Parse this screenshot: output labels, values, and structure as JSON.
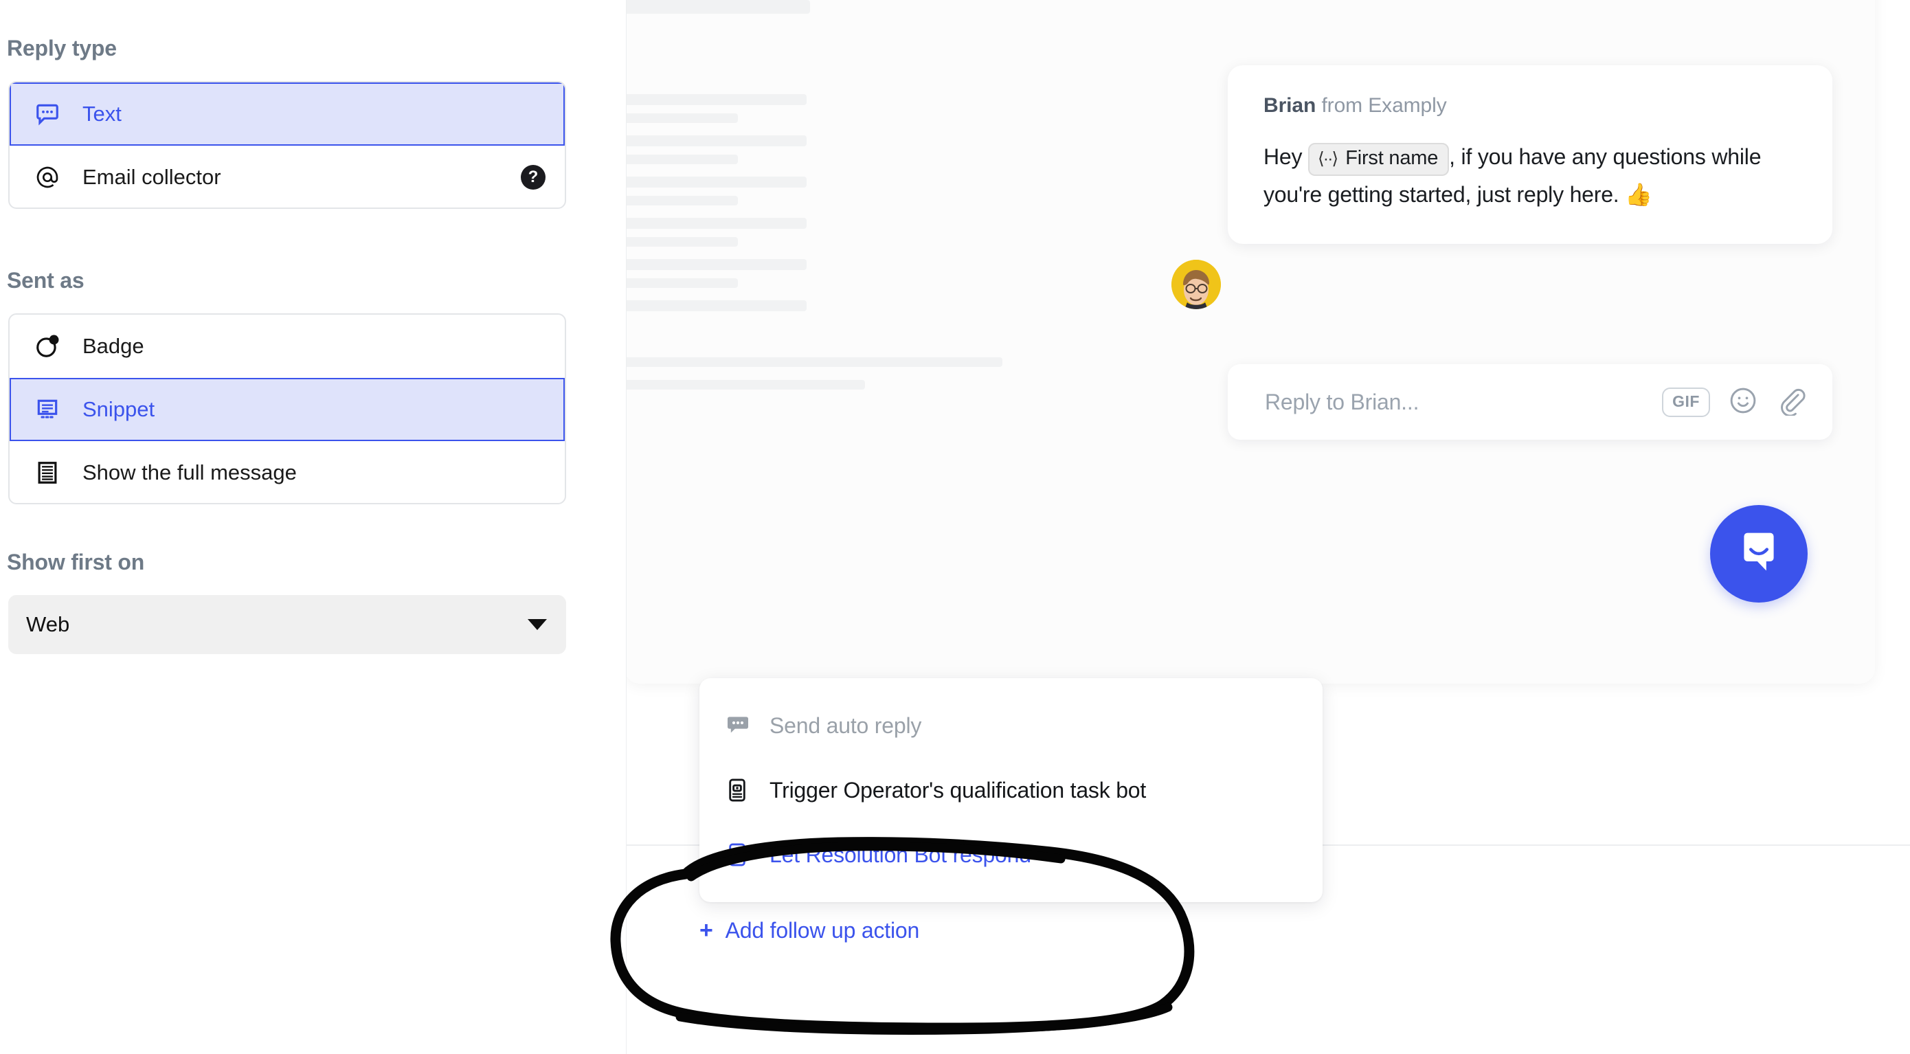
{
  "sidebar": {
    "reply_type": {
      "label": "Reply type",
      "options": [
        {
          "label": "Text",
          "icon": "chat-bubble-dots-icon",
          "selected": true,
          "help": null
        },
        {
          "label": "Email collector",
          "icon": "at-sign-icon",
          "selected": false,
          "help": "?"
        }
      ]
    },
    "sent_as": {
      "label": "Sent as",
      "options": [
        {
          "label": "Badge",
          "icon": "badge-dot-icon",
          "selected": false
        },
        {
          "label": "Snippet",
          "icon": "snippet-icon",
          "selected": true
        },
        {
          "label": "Show the full message",
          "icon": "full-message-icon",
          "selected": false
        }
      ]
    },
    "show_first_on": {
      "label": "Show first on",
      "value": "Web",
      "caret_icon": "caret-down-icon"
    }
  },
  "preview": {
    "message": {
      "sender_name": "Brian",
      "sender_suffix": "from Examply",
      "body_before": "Hey",
      "attribute_pill": {
        "icon": "code-attribute-icon",
        "label": "First name"
      },
      "body_after": ", if you have any questions while you're getting started, just reply here.",
      "emoji": "👍",
      "avatar_name": "avatar"
    },
    "composer": {
      "placeholder": "Reply to Brian...",
      "tools": [
        {
          "name": "gif-button",
          "label": "GIF"
        },
        {
          "name": "emoji-button",
          "label": "emoji-smiley-icon"
        },
        {
          "name": "attachment-button",
          "label": "paperclip-icon"
        }
      ]
    },
    "launcher": {
      "name": "messenger-launcher-button",
      "icon": "intercom-logo-icon"
    }
  },
  "actions_menu": {
    "items": [
      {
        "label": "Send auto reply",
        "icon": "chat-bubble-dots-icon",
        "state": "muted"
      },
      {
        "label": "Trigger Operator's qualification task bot",
        "icon": "bot-icon",
        "state": "dark"
      },
      {
        "label": "Let Resolution Bot respond",
        "icon": "bot-icon",
        "state": "accent"
      }
    ],
    "add_action": {
      "plus": "+",
      "label": "Add follow up action"
    }
  },
  "annotation": {
    "type": "hand-drawn-circle",
    "color": "#000000"
  },
  "colors": {
    "accent": "#3b53ec",
    "accent_bg": "#dfe3fb",
    "muted_text": "#6e7a87",
    "avatar_bg": "#f0c419",
    "skeleton": "#f1f2f3"
  }
}
